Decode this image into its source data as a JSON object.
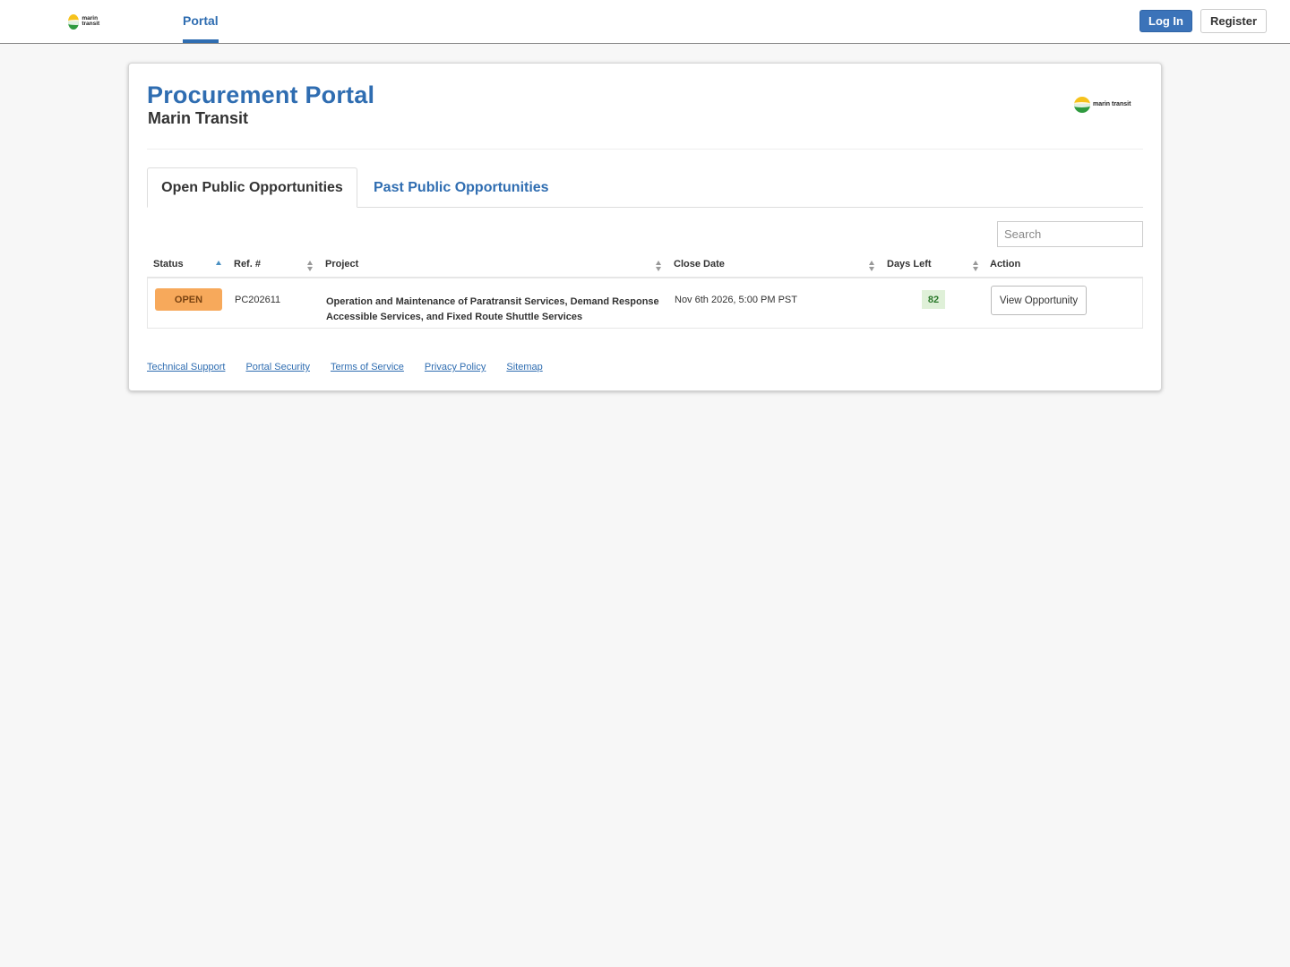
{
  "topnav": {
    "logo_text": "marin transit",
    "tab_label": "Portal",
    "login_label": "Log In",
    "register_label": "Register"
  },
  "header": {
    "title": "Procurement Portal",
    "subtitle": "Marin Transit",
    "logo_text": "marin transit"
  },
  "tabs": [
    {
      "label": "Open Public Opportunities",
      "active": true
    },
    {
      "label": "Past Public Opportunities",
      "active": false
    }
  ],
  "search": {
    "placeholder": "Search",
    "value": ""
  },
  "table": {
    "columns": [
      "Status",
      "Ref. #",
      "Project",
      "Close Date",
      "Days Left",
      "Action"
    ],
    "rows": [
      {
        "status": "OPEN",
        "ref": "PC202611",
        "project": "Operation and Maintenance of Paratransit Services, Demand Response Accessible Services, and Fixed Route Shuttle Services",
        "close_date": "Nov 6th 2026, 5:00 PM PST",
        "days_left": "82",
        "action": "View Opportunity"
      }
    ]
  },
  "footer": {
    "links": [
      "Technical Support",
      "Portal Security",
      "Terms of Service",
      "Privacy Policy",
      "Sitemap"
    ]
  },
  "colors": {
    "brand_blue": "#2f6db1",
    "open_badge": "#f7a95b",
    "days_badge_bg": "#dff0d8"
  }
}
